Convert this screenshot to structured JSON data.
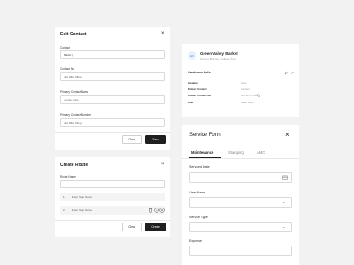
{
  "edit_contact": {
    "title": "Edit Contact",
    "fields": [
      {
        "label": "Contact",
        "value": "Martin |"
      },
      {
        "label": "Contact No",
        "value": "+91 98xx 98xxx"
      },
      {
        "label": "Primary Contact Name",
        "value": "Jennie Joins"
      },
      {
        "label": "Primary Contact Number",
        "value": "+91 98xx 93xyz"
      }
    ],
    "clear_label": "Clear",
    "save_label": "Save"
  },
  "create_route": {
    "title": "Create Route",
    "route_name_label": "Route Name",
    "stops": [
      {
        "number": "1",
        "placeholder": "Enter Stop Name"
      },
      {
        "number": "2",
        "placeholder": "Enter Stop Name"
      }
    ],
    "clear_label": "Clear",
    "create_label": "Create"
  },
  "customer_card": {
    "avatar_text": "GV",
    "name": "Green Valley Market",
    "subtitle": "Grocery Business, Indiana, Pune",
    "section_title": "Customer Info",
    "rows": [
      {
        "key": "Location",
        "value": "Pune"
      },
      {
        "key": "Primary Contact",
        "value": "Contact"
      },
      {
        "key": "Primary Contact No",
        "value": "+91 9876 54321"
      },
      {
        "key": "Role",
        "value": "Sales Head"
      }
    ]
  },
  "service_form": {
    "title": "Service Form",
    "tabs": [
      "Maintenance",
      "Stamping",
      "AMC"
    ],
    "active_tab": 0,
    "fields": [
      {
        "label": "Serviced Date"
      },
      {
        "label": "User Name"
      },
      {
        "label": "Service Type"
      },
      {
        "label": "Expense"
      }
    ]
  }
}
